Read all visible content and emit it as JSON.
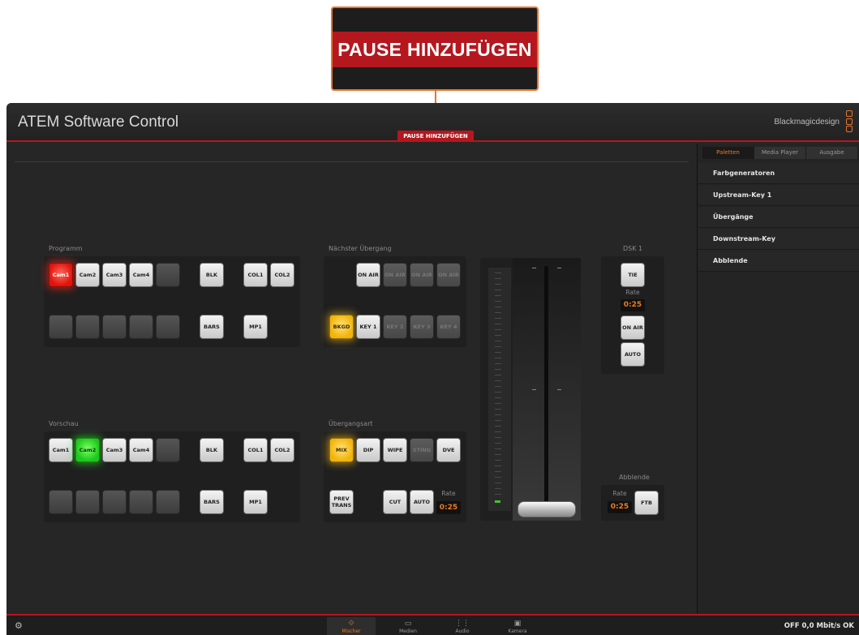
{
  "callout": {
    "text": "PAUSE HINZUFÜGEN"
  },
  "app": {
    "title": "ATEM Software Control",
    "pause_button": "PAUSE HINZUFÜGEN",
    "brand": "Blackmagicdesign"
  },
  "programm": {
    "label": "Programm",
    "row1": [
      "Cam1",
      "Cam2",
      "Cam3",
      "Cam4",
      "",
      "BLK",
      "COL1",
      "COL2"
    ],
    "row2": [
      "",
      "",
      "",
      "",
      "",
      "BARS",
      "MP1"
    ],
    "active": "Cam1"
  },
  "vorschau": {
    "label": "Vorschau",
    "row1": [
      "Cam1",
      "Cam2",
      "Cam3",
      "Cam4",
      "",
      "BLK",
      "COL1",
      "COL2"
    ],
    "row2": [
      "",
      "",
      "",
      "",
      "",
      "BARS",
      "MP1"
    ],
    "active": "Cam2"
  },
  "naechster": {
    "label": "Nächster Übergang",
    "onair": [
      "ON AIR",
      "ON AIR",
      "ON AIR",
      "ON AIR"
    ],
    "keys": [
      "BKGD",
      "KEY 1",
      "KEY 2",
      "KEY 3",
      "KEY 4"
    ]
  },
  "uebergangsart": {
    "label": "Übergangsart",
    "types": [
      "MIX",
      "DIP",
      "WIPE",
      "STING",
      "DVE"
    ],
    "prev_trans": "PREV TRANS",
    "cut": "CUT",
    "auto": "AUTO",
    "rate_label": "Rate",
    "rate": "0:25"
  },
  "dsk": {
    "label": "DSK 1",
    "tie": "TIE",
    "rate_label": "Rate",
    "rate": "0:25",
    "onair": "ON AIR",
    "auto": "AUTO"
  },
  "abblende": {
    "label": "Abblende",
    "rate_label": "Rate",
    "rate": "0:25",
    "ftb": "FTB"
  },
  "sidebar": {
    "tabs": [
      "Paletten",
      "Media Player",
      "Ausgabe"
    ],
    "items": [
      "Farbgeneratoren",
      "Upstream-Key 1",
      "Übergänge",
      "Downstream-Key",
      "Abblende"
    ]
  },
  "bottom": {
    "tabs": [
      "Mischer",
      "Medien",
      "Audio",
      "Kamera"
    ],
    "status": "OFF 0,0 Mbit/s OK"
  },
  "colors": {
    "accent": "#f07a1d",
    "brand_red": "#b5171e",
    "program_red": "#e0140c",
    "preview_green": "#1ec91a",
    "yellow": "#f2b40b"
  }
}
